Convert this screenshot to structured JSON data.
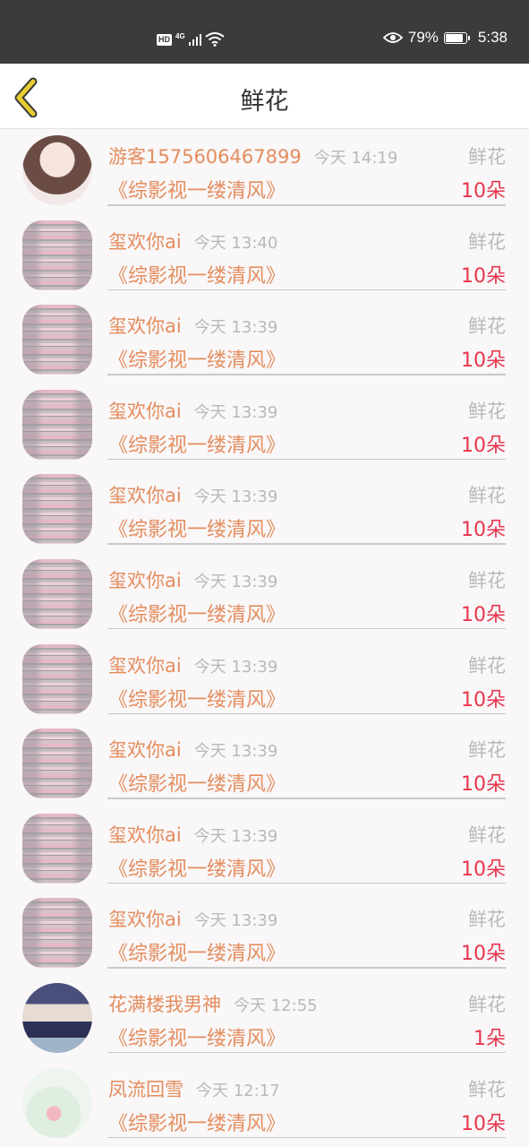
{
  "status_bar": {
    "hd": "HD",
    "network": "4G",
    "battery_percent": "79%",
    "battery_level": 0.79,
    "time": "5:38"
  },
  "navbar": {
    "title": "鲜花",
    "back_icon": "chevron-left-icon",
    "accent": "#e9cc2f"
  },
  "colors": {
    "name": "#e48d5e",
    "muted": "#b9b9b9",
    "count": "#e8364e"
  },
  "items": [
    {
      "user": "游客1575606467899",
      "time": "今天 14:19",
      "kind": "鲜花",
      "book": "《综影视一缕清风》",
      "count": "10朵",
      "avatar": "girl-avatar"
    },
    {
      "user": "玺欢你ai",
      "time": "今天 13:40",
      "kind": "鲜花",
      "book": "《综影视一缕清风》",
      "count": "10朵",
      "avatar": "glitch-avatar"
    },
    {
      "user": "玺欢你ai",
      "time": "今天 13:39",
      "kind": "鲜花",
      "book": "《综影视一缕清风》",
      "count": "10朵",
      "avatar": "glitch-avatar"
    },
    {
      "user": "玺欢你ai",
      "time": "今天 13:39",
      "kind": "鲜花",
      "book": "《综影视一缕清风》",
      "count": "10朵",
      "avatar": "glitch-avatar"
    },
    {
      "user": "玺欢你ai",
      "time": "今天 13:39",
      "kind": "鲜花",
      "book": "《综影视一缕清风》",
      "count": "10朵",
      "avatar": "glitch-avatar"
    },
    {
      "user": "玺欢你ai",
      "time": "今天 13:39",
      "kind": "鲜花",
      "book": "《综影视一缕清风》",
      "count": "10朵",
      "avatar": "glitch-avatar"
    },
    {
      "user": "玺欢你ai",
      "time": "今天 13:39",
      "kind": "鲜花",
      "book": "《综影视一缕清风》",
      "count": "10朵",
      "avatar": "glitch-avatar"
    },
    {
      "user": "玺欢你ai",
      "time": "今天 13:39",
      "kind": "鲜花",
      "book": "《综影视一缕清风》",
      "count": "10朵",
      "avatar": "glitch-avatar"
    },
    {
      "user": "玺欢你ai",
      "time": "今天 13:39",
      "kind": "鲜花",
      "book": "《综影视一缕清风》",
      "count": "10朵",
      "avatar": "glitch-avatar"
    },
    {
      "user": "玺欢你ai",
      "time": "今天 13:39",
      "kind": "鲜花",
      "book": "《综影视一缕清风》",
      "count": "10朵",
      "avatar": "glitch-avatar"
    },
    {
      "user": "花满楼我男神",
      "time": "今天 12:55",
      "kind": "鲜花",
      "book": "《综影视一缕清风》",
      "count": "1朵",
      "avatar": "photo-avatar"
    },
    {
      "user": "凤流回雪",
      "time": "今天 12:17",
      "kind": "鲜花",
      "book": "《综影视一缕清风》",
      "count": "10朵",
      "avatar": "flower-avatar"
    }
  ]
}
